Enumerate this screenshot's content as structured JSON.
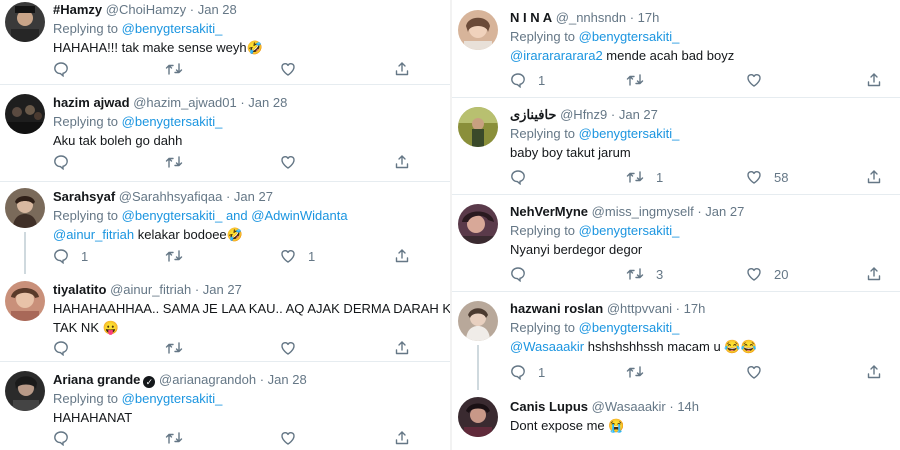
{
  "left": {
    "tweets": [
      {
        "name": "#Hamzy",
        "handle": "@ChoiHamzy",
        "time": "Jan 28",
        "replying_prefix": "Replying to",
        "replying_to": "@benygtersakiti_",
        "text": "HAHAHA!!! tak make sense weyh🤣",
        "avatar_color": "#3a3a3a",
        "reply_count": "",
        "retweet_count": "",
        "like_count": ""
      },
      {
        "name": "hazim ajwad",
        "handle": "@hazim_ajwad01",
        "time": "Jan 28",
        "replying_prefix": "Replying to",
        "replying_to": "@benygtersakiti_",
        "text": "Aku tak boleh go dahh",
        "avatar_color": "#1e1e1e",
        "reply_count": "",
        "retweet_count": "",
        "like_count": ""
      },
      {
        "name": "Sarahsyaf",
        "handle": "@Sarahhsyafiqaa",
        "time": "Jan 27",
        "replying_prefix": "Replying to",
        "replying_to": "@benygtersakiti_",
        "and_word": "and",
        "replying_to_2": "@AdwinWidanta",
        "mention_inline": "@ainur_fitriah",
        "text": "kelakar bodoee🤣",
        "avatar_color": "#7a6a5a",
        "reply_count": "1",
        "retweet_count": "",
        "like_count": "1"
      },
      {
        "name": "tiyalatito",
        "handle": "@ainur_fitriah",
        "time": "Jan 27",
        "text_line1": "HAHAHAAHHAA.. SAMA JE LAA KAU.. AQ AJAK DERMA DARAH KA",
        "text_line2": "TAK NK 😛",
        "avatar_color": "#c9907a",
        "reply_count": "",
        "retweet_count": "",
        "like_count": ""
      },
      {
        "name": "Ariana grande",
        "handle": "@arianagrandoh",
        "time": "Jan 28",
        "replying_prefix": "Replying to",
        "replying_to": "@benygtersakiti_",
        "text": "HAHAHANAT",
        "avatar_color": "#2b2b2b",
        "reply_count": "",
        "retweet_count": "",
        "like_count": ""
      }
    ]
  },
  "right": {
    "tweets": [
      {
        "name": "N I N A",
        "handle": "@_nnhsndn",
        "time": "17h",
        "replying_prefix": "Replying to",
        "replying_to": "@benygtersakiti_",
        "mention_inline": "@irararararara2",
        "text": "mende acah bad boyz",
        "avatar_color": "#d7b49a",
        "reply_count": "1",
        "retweet_count": "",
        "like_count": ""
      },
      {
        "name": "حافينازى",
        "handle": "@Hfnz9",
        "time": "Jan 27",
        "replying_prefix": "Replying to",
        "replying_to": "@benygtersakiti_",
        "text": "baby boy takut jarum",
        "avatar_color": "#8a8f3a",
        "reply_count": "",
        "retweet_count": "1",
        "like_count": "58"
      },
      {
        "name": "NehVerMyne",
        "handle": "@miss_ingmyself",
        "time": "Jan 27",
        "replying_prefix": "Replying to",
        "replying_to": "@benygtersakiti_",
        "text": "Nyanyi berdegor degor",
        "avatar_color": "#5a3a4a",
        "reply_count": "",
        "retweet_count": "3",
        "like_count": "20"
      },
      {
        "name": "hazwani roslan",
        "handle": "@httpvvani",
        "time": "17h",
        "replying_prefix": "Replying to",
        "replying_to": "@benygtersakiti_",
        "mention_inline": "@Wasaaakir",
        "text": "hshshshhssh macam u 😂😂",
        "avatar_color": "#b8a89a",
        "reply_count": "1",
        "retweet_count": "",
        "like_count": ""
      },
      {
        "name": "Canis Lupus",
        "handle": "@Wasaaakir",
        "time": "14h",
        "text": "Dont expose me 😭",
        "avatar_color": "#3a2a30",
        "reply_count": "",
        "retweet_count": "",
        "like_count": ""
      }
    ]
  },
  "colors": {
    "link": "#1b95e0",
    "muted": "#657786",
    "text": "#14171a",
    "separator": "#e6ecf0",
    "thread_line": "#cfd9de"
  },
  "icons": [
    "reply-icon",
    "retweet-icon",
    "like-icon",
    "share-icon",
    "verified-icon"
  ]
}
